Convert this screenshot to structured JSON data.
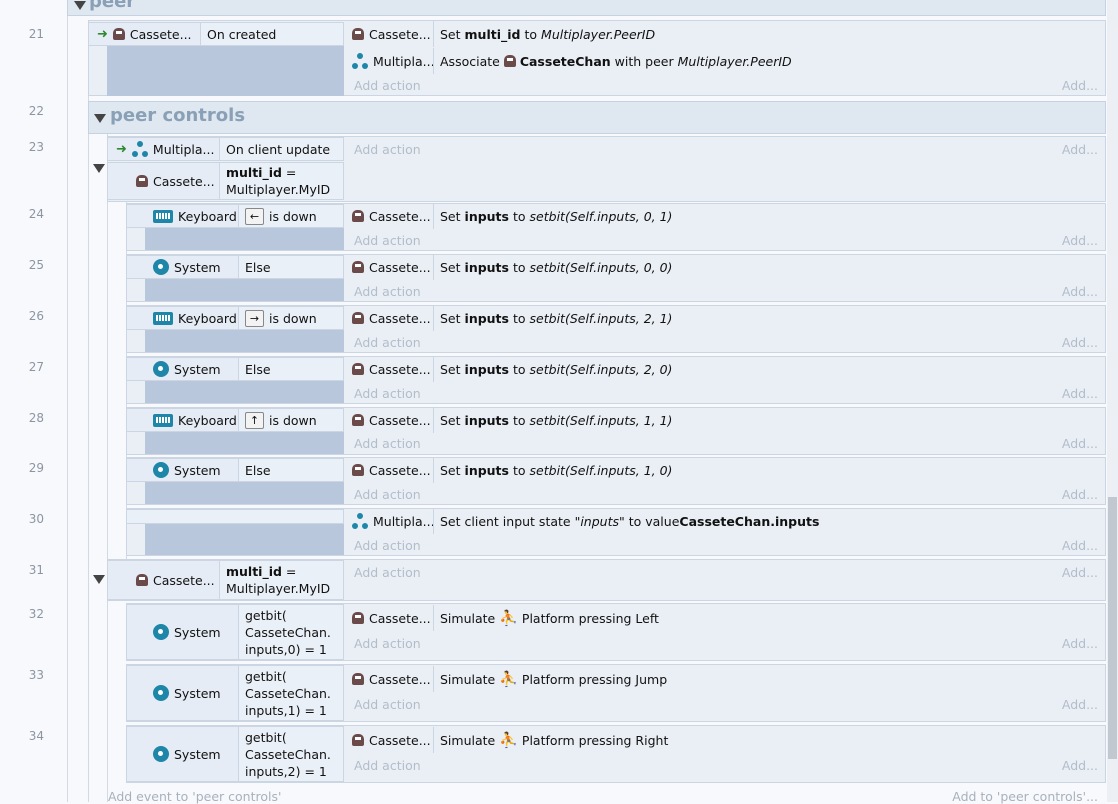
{
  "groups": {
    "peer": "peer",
    "controls": "peer controls"
  },
  "placeholders": {
    "add_action": "Add action",
    "add": "Add..."
  },
  "objects": {
    "cassete": "Cassete...",
    "multiplayer": "Multipla...",
    "multiplayer_long": "Multiplayer",
    "keyboard": "Keyboard",
    "system": "System"
  },
  "rows": {
    "r21": {
      "num": "21",
      "cond": "On created",
      "a1": {
        "pre": "Set ",
        "b": "multi_id",
        "mid": " to ",
        "i": "Multiplayer.PeerID"
      },
      "a2": {
        "pre": "Associate ",
        "b": "CasseteChan",
        "mid": " with peer ",
        "i": "Multiplayer.PeerID"
      }
    },
    "r22": {
      "num": "22"
    },
    "r23": {
      "num": "23",
      "cond1": "On client update",
      "cond2_b": "multi_id",
      "cond2_eq": " =",
      "cond2_val": "Multiplayer.MyID"
    },
    "r24": {
      "num": "24",
      "key": "←",
      "cond": "is down",
      "set": "Set ",
      "var": "inputs",
      "to": " to ",
      "expr": "setbit(Self.inputs, 0, 1)"
    },
    "r25": {
      "num": "25",
      "cond": "Else",
      "set": "Set ",
      "var": "inputs",
      "to": " to ",
      "expr": "setbit(Self.inputs, 0, 0)"
    },
    "r26": {
      "num": "26",
      "key": "→",
      "cond": "is down",
      "set": "Set ",
      "var": "inputs",
      "to": " to ",
      "expr": "setbit(Self.inputs, 2, 1)"
    },
    "r27": {
      "num": "27",
      "cond": "Else",
      "set": "Set ",
      "var": "inputs",
      "to": " to ",
      "expr": "setbit(Self.inputs, 2, 0)"
    },
    "r28": {
      "num": "28",
      "key": "↑",
      "cond": "is down",
      "set": "Set ",
      "var": "inputs",
      "to": " to ",
      "expr": "setbit(Self.inputs, 1, 1)"
    },
    "r29": {
      "num": "29",
      "cond": "Else",
      "set": "Set ",
      "var": "inputs",
      "to": " to ",
      "expr": "setbit(Self.inputs, 1, 0)"
    },
    "r30": {
      "num": "30",
      "pre": "Set client input state \"",
      "i": "inputs",
      "mid": "\" to value ",
      "b": "CasseteChan.inputs"
    },
    "r31": {
      "num": "31",
      "cond_b": "multi_id",
      "cond_eq": " =",
      "cond_val": "Multiplayer.MyID"
    },
    "r32": {
      "num": "32",
      "c1": "getbit(",
      "c2": "CasseteChan.",
      "c3": "inputs,0) = 1",
      "sim": "Simulate",
      "plat": "Platform pressing Left"
    },
    "r33": {
      "num": "33",
      "c1": "getbit(",
      "c2": "CasseteChan.",
      "c3": "inputs,1) = 1",
      "sim": "Simulate",
      "plat": "Platform pressing Jump"
    },
    "r34": {
      "num": "34",
      "c1": "getbit(",
      "c2": "CasseteChan.",
      "c3": "inputs,2) = 1",
      "sim": "Simulate",
      "plat": "Platform pressing Right"
    }
  },
  "footer": {
    "left": "Add event to 'peer controls'",
    "right": "Add to 'peer controls'..."
  }
}
